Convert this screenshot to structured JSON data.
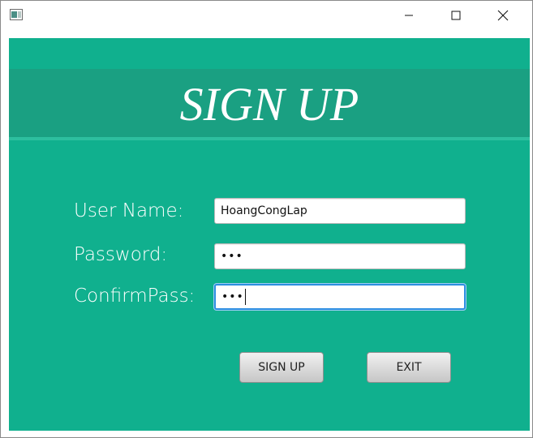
{
  "window": {
    "controls": {
      "minimize_icon": "minimize-icon",
      "maximize_icon": "maximize-icon",
      "close_icon": "close-icon"
    }
  },
  "header": {
    "title": "SIGN UP"
  },
  "form": {
    "username_label": "User Name:",
    "username_value": "HoangCongLap",
    "password_label": "Password:",
    "password_value": "•••",
    "confirm_label": "ConfirmPass:",
    "confirm_value": "•••"
  },
  "actions": {
    "signup_label": "SIGN UP",
    "exit_label": "EXIT"
  },
  "colors": {
    "background": "#10b08e",
    "header_band": "#1aa082",
    "focus_border": "#2d8fe0"
  }
}
